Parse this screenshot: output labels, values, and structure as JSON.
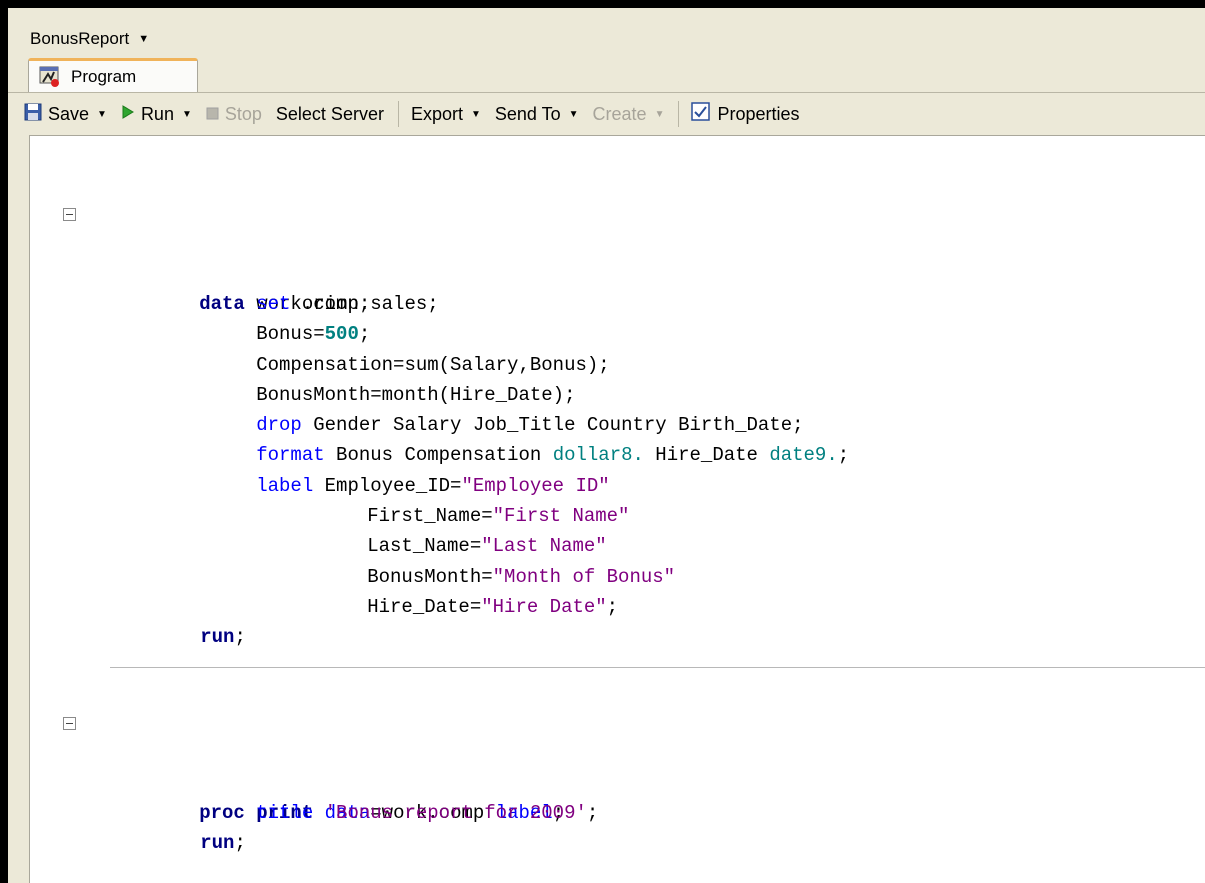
{
  "window": {
    "title": "BonusReport"
  },
  "tab": {
    "label": "Program"
  },
  "toolbar": {
    "save": "Save",
    "run": "Run",
    "stop": "Stop",
    "select_server": "Select Server",
    "export": "Export",
    "send_to": "Send To",
    "create": "Create",
    "properties": "Properties"
  },
  "code": {
    "l1": [
      "data",
      " work.comp;"
    ],
    "l2": [
      "set",
      " orion.sales;"
    ],
    "l3": [
      "Bonus=",
      "500",
      ";"
    ],
    "l4": [
      "Compensation=sum(Salary,Bonus);"
    ],
    "l5": [
      "BonusMonth=month(Hire_Date);"
    ],
    "l6": [
      "drop",
      " Gender Salary Job_Title Country Birth_Date;"
    ],
    "l7": [
      "format",
      " Bonus Compensation ",
      "dollar8.",
      " Hire_Date ",
      "date9.",
      ";"
    ],
    "l8": [
      "label",
      " Employee_ID=",
      "\"Employee ID\""
    ],
    "l9": [
      "First_Name=",
      "\"First Name\""
    ],
    "l10": [
      "Last_Name=",
      "\"Last Name\""
    ],
    "l11": [
      "BonusMonth=",
      "\"Month of Bonus\""
    ],
    "l12": [
      "Hire_Date=",
      "\"Hire Date\"",
      ";"
    ],
    "l13": [
      "run",
      ";"
    ],
    "l14": [
      "proc print",
      " data",
      "=work.comp ",
      "label",
      ";"
    ],
    "l15": [
      "title",
      " ",
      "'Bonus report for 2009'",
      ";"
    ],
    "l16": [
      "run",
      ";"
    ]
  }
}
